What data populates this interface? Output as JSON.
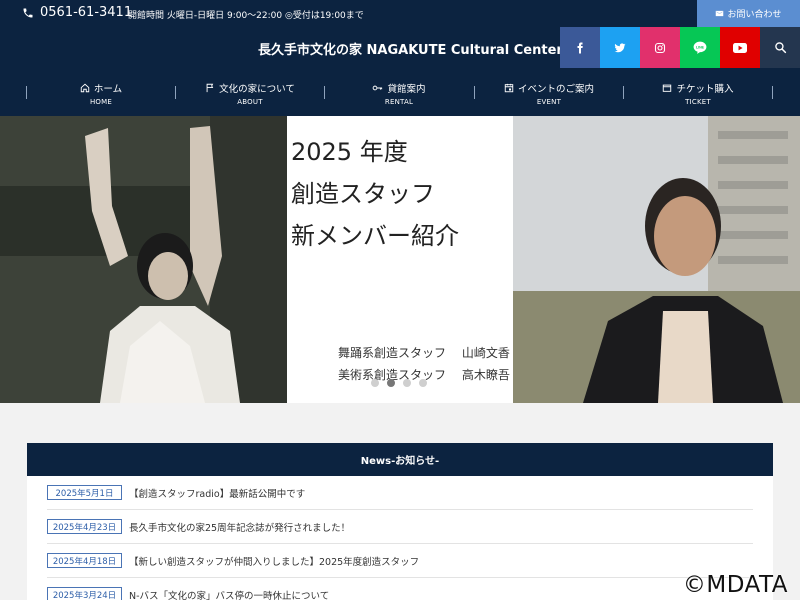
{
  "topbar": {
    "phone": "0561-61-3411",
    "hours": "開館時間 火曜日-日曜日 9:00〜22:00 ◎受付は19:00まで",
    "contact": "お問い合わせ"
  },
  "header": {
    "site_title": "長久手市文化の家 NAGAKUTE Cultural Center"
  },
  "social": [
    {
      "icon": "facebook-icon",
      "color": "#3b5998"
    },
    {
      "icon": "twitter-icon",
      "color": "#1da1f2"
    },
    {
      "icon": "instagram-icon",
      "color": "#e1306c"
    },
    {
      "icon": "line-icon",
      "color": "#06c755"
    },
    {
      "icon": "youtube-icon",
      "color": "#e00000"
    },
    {
      "icon": "search-icon",
      "color": "#24364f"
    }
  ],
  "nav": [
    {
      "label": "ホーム",
      "sub": "HOME",
      "icon": "home-icon"
    },
    {
      "label": "文化の家について",
      "sub": "ABOUT",
      "icon": "flag-icon"
    },
    {
      "label": "貸館案内",
      "sub": "RENTAL",
      "icon": "key-icon"
    },
    {
      "label": "イベントのご案内",
      "sub": "EVENT",
      "icon": "calendar-icon"
    },
    {
      "label": "チケット購入",
      "sub": "TICKET",
      "icon": "ticket-icon"
    }
  ],
  "hero": {
    "title_lines": [
      "2025 年度",
      "創造スタッフ",
      "新メンバー紹介"
    ],
    "staff": [
      {
        "role": "舞踊系創造スタッフ",
        "name": "山崎文香"
      },
      {
        "role": "美術系創造スタッフ",
        "name": "高木瞭吾"
      }
    ]
  },
  "news": {
    "heading": "News-お知らせ-",
    "items": [
      {
        "date": "2025年5月1日",
        "text": "【創造スタッフradio】最新話公開中です"
      },
      {
        "date": "2025年4月23日",
        "text": "長久手市文化の家25周年記念誌が発行されました！"
      },
      {
        "date": "2025年4月18日",
        "text": "【新しい創造スタッフが仲間入りしました】2025年度創造スタッフ"
      },
      {
        "date": "2025年3月24日",
        "text": "N-バス「文化の家」バス停の一時休止について"
      }
    ]
  },
  "watermark": "©MDATA"
}
